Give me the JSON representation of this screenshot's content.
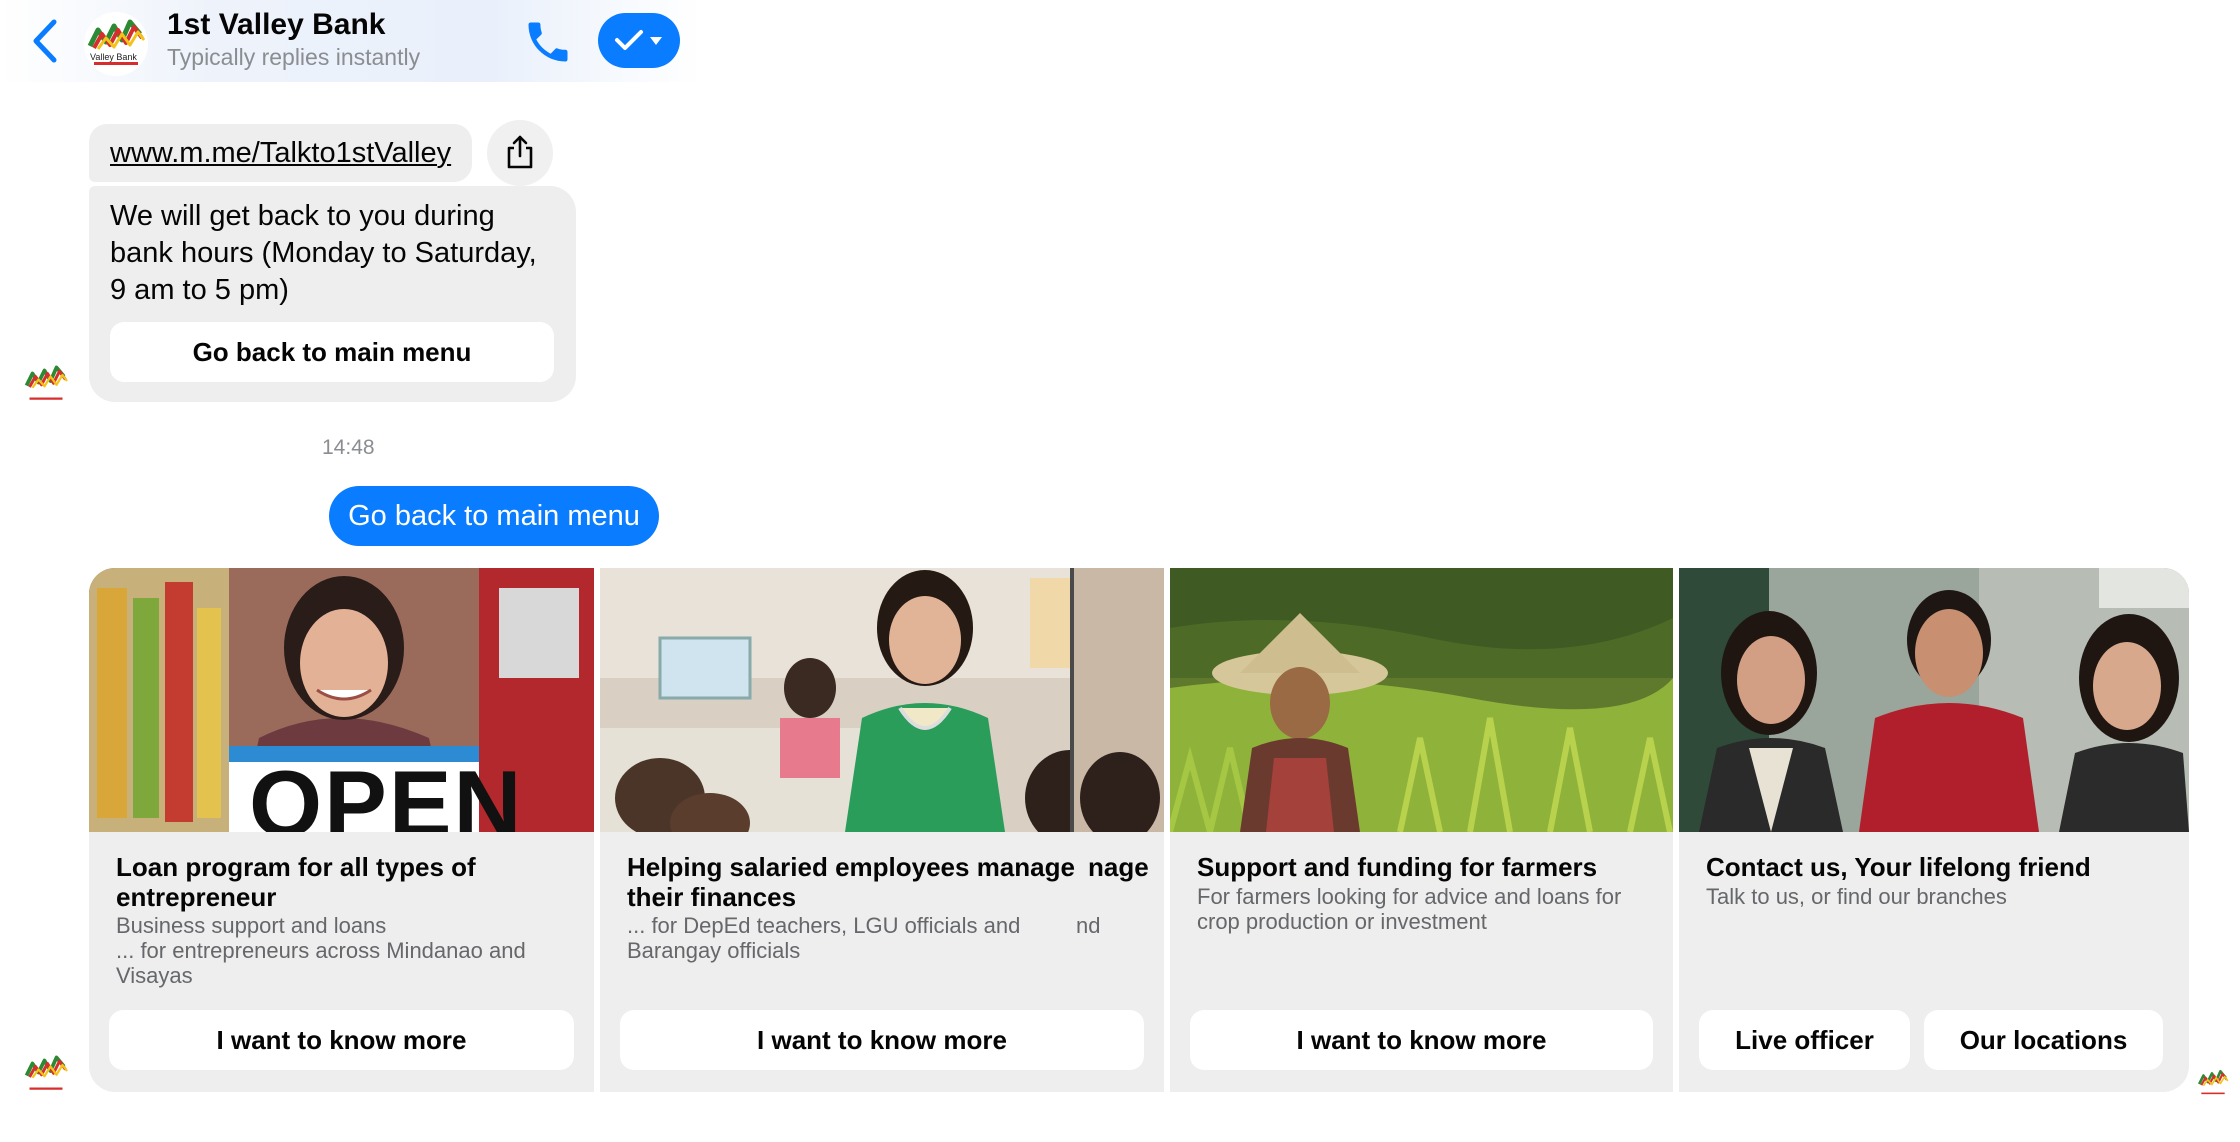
{
  "header": {
    "title": "1st Valley Bank",
    "subtitle": "Typically replies instantly",
    "logo_text": "Valley Bank"
  },
  "messages": {
    "link": "www.m.me/Talkto1stValley",
    "hours_text": "We will get back to you during bank hours (Monday to Saturday, 9 am to 5 pm)",
    "hours_button": "Go back to main menu",
    "timestamp": "14:48",
    "outgoing": "Go back to main menu"
  },
  "cards": [
    {
      "title": "Loan program for all types of entrepreneur",
      "subtitle_1": "Business support and loans",
      "subtitle_2": "... for entrepreneurs across Mindanao and Visayas",
      "button": "I want to know more",
      "image_text": "OPEN"
    },
    {
      "title": "Helping salaried employees manage their finances",
      "title_ghost": "nage",
      "subtitle_1": "... for DepEd teachers, LGU officials and Barangay officials",
      "subtitle_ghost": "nd",
      "button": "I want to know more"
    },
    {
      "title": "Support and funding for farmers",
      "subtitle_1": "For farmers looking for advice and loans for crop production or investment",
      "button": "I want to know more"
    },
    {
      "title": "Contact us, Your lifelong friend",
      "subtitle_1": "Talk to us, or find our branches",
      "button_1": "Live officer",
      "button_2": "Our locations"
    }
  ],
  "colors": {
    "accent": "#0a7cff",
    "bubble": "#eeeeee",
    "muted_text": "#8a8d91"
  }
}
